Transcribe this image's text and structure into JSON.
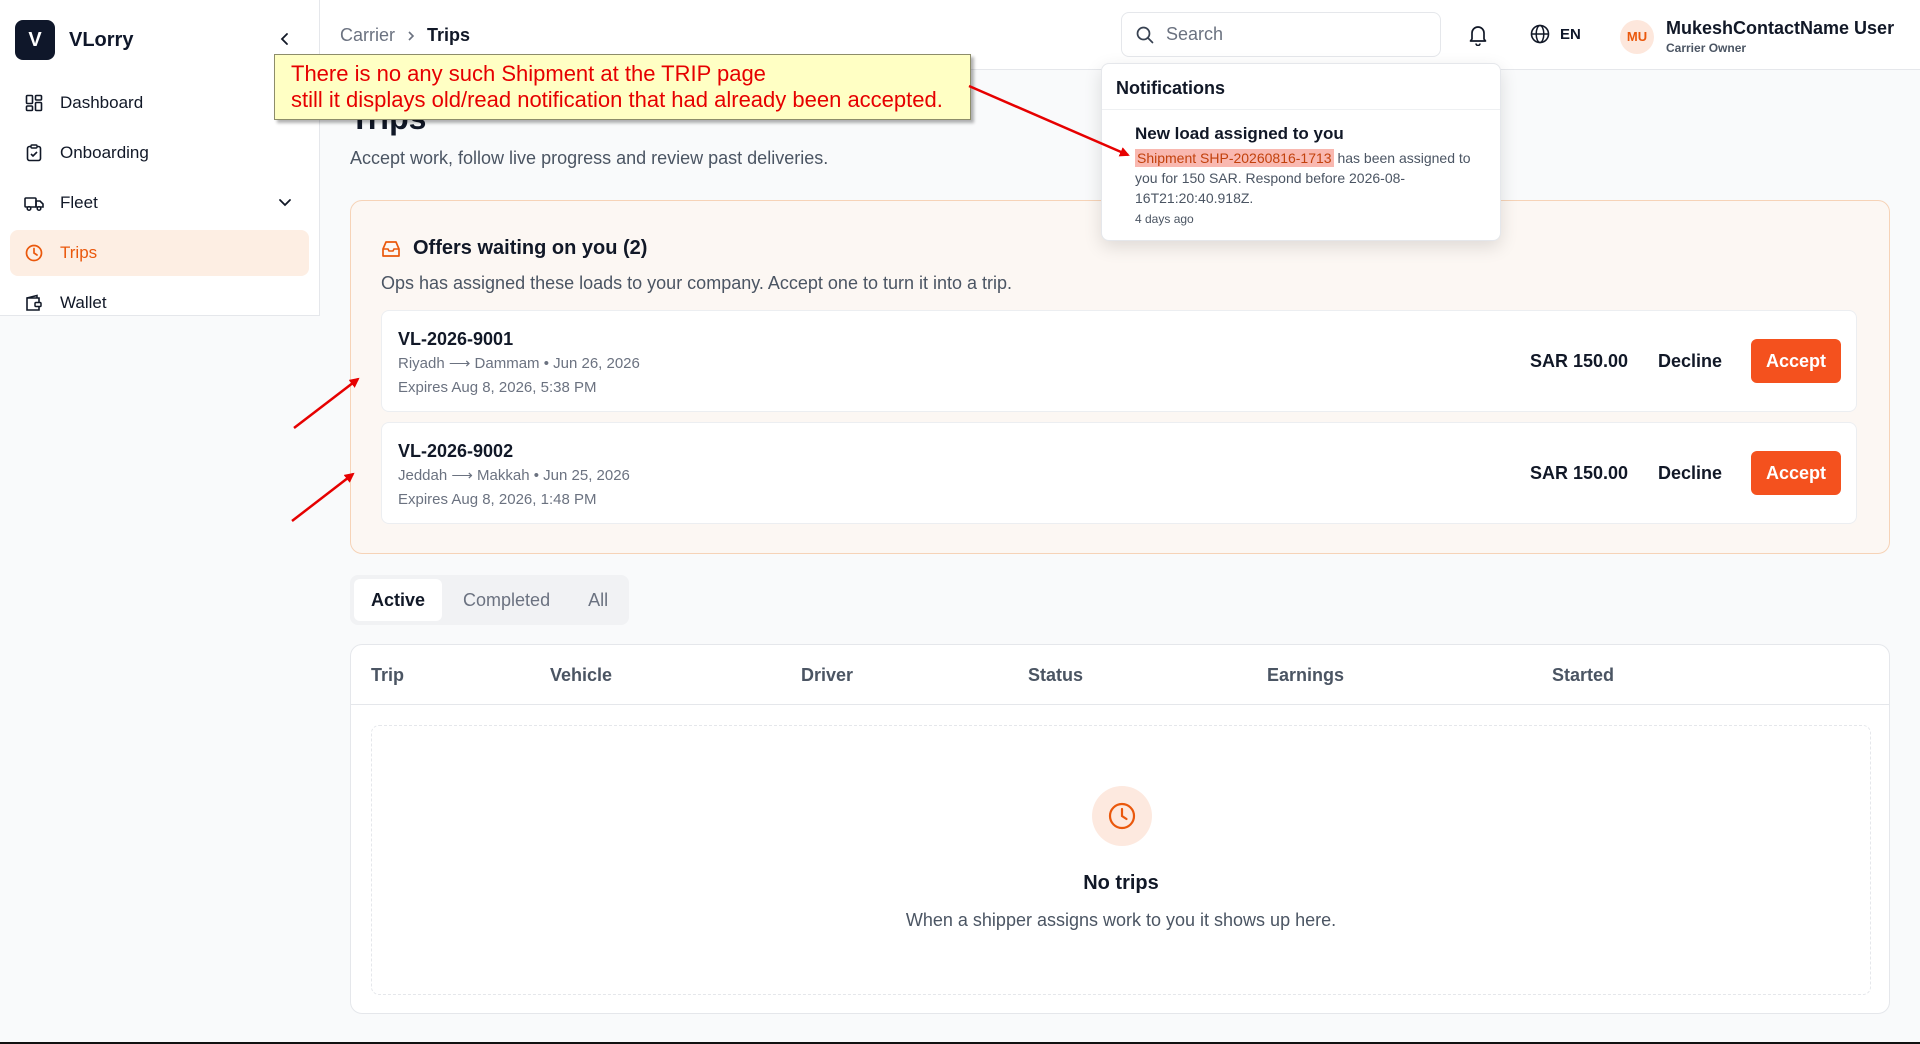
{
  "sidebar": {
    "brand_letter": "V",
    "brand_name": "VLorry",
    "items": [
      {
        "label": "Dashboard",
        "icon": "dashboard-icon"
      },
      {
        "label": "Onboarding",
        "icon": "clipboard-icon"
      },
      {
        "label": "Fleet",
        "icon": "truck-icon"
      },
      {
        "label": "Trips",
        "icon": "clock-icon",
        "active": true
      },
      {
        "label": "Wallet",
        "icon": "wallet-icon"
      }
    ]
  },
  "header": {
    "breadcrumb": {
      "root": "Carrier",
      "current": "Trips"
    },
    "search_placeholder": "Search",
    "language": "EN",
    "user": {
      "initials": "MU",
      "name": "MukeshContactName User",
      "role": "Carrier Owner"
    }
  },
  "page": {
    "title": "Trips",
    "subtitle": "Accept work, follow live progress and review past deliveries."
  },
  "offers": {
    "heading": "Offers waiting on you (2)",
    "description": "Ops has assigned these loads to your company. Accept one to turn it into a trip.",
    "items": [
      {
        "id": "VL-2026-9001",
        "route": "Riyadh ⟶ Dammam • Jun 26, 2026",
        "expires": "Expires Aug 8, 2026, 5:38 PM",
        "price": "SAR 150.00",
        "decline": "Decline",
        "accept": "Accept"
      },
      {
        "id": "VL-2026-9002",
        "route": "Jeddah ⟶ Makkah • Jun 25, 2026",
        "expires": "Expires Aug 8, 2026, 1:48 PM",
        "price": "SAR 150.00",
        "decline": "Decline",
        "accept": "Accept"
      }
    ]
  },
  "tabs": [
    "Active",
    "Completed",
    "All"
  ],
  "table": {
    "columns": [
      "Trip",
      "Vehicle",
      "Driver",
      "Status",
      "Earnings",
      "Started"
    ],
    "empty_title": "No trips",
    "empty_desc": "When a shipper assigns work to you it shows up here."
  },
  "notifications": {
    "heading": "Notifications",
    "item": {
      "title": "New load assigned to you",
      "shipment": "Shipment SHP-20260816-1713",
      "body_rest": " has been assigned to you for 150 SAR. Respond before 2026-08-16T21:20:40.918Z.",
      "time": "4 days ago"
    }
  },
  "annotation": {
    "line1": "There is no any such Shipment at the TRIP page",
    "line2": "still it displays old/read notification that had already been accepted."
  },
  "colors": {
    "accent": "#f4511e",
    "annotation_red": "#e60000",
    "callout_bg": "#ffffc4"
  }
}
